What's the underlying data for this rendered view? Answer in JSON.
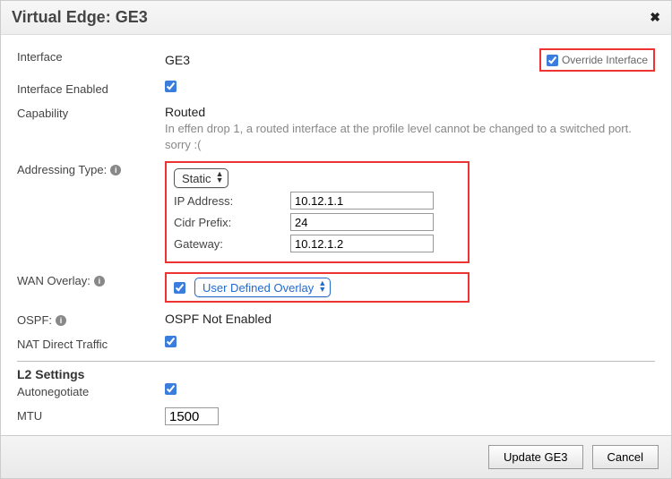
{
  "title": "Virtual Edge: GE3",
  "override": {
    "label": "Override Interface",
    "checked": true
  },
  "rows": {
    "interface": {
      "label": "Interface",
      "value": "GE3"
    },
    "enabled": {
      "label": "Interface Enabled",
      "checked": true
    },
    "capability": {
      "label": "Capability",
      "value": "Routed",
      "note": "In effen drop 1, a routed interface at the profile level cannot be changed to a switched port. sorry :("
    },
    "addressing": {
      "label": "Addressing Type:",
      "select": "Static",
      "ip_label": "IP Address:",
      "ip": "10.12.1.1",
      "cidr_label": "Cidr Prefix:",
      "cidr": "24",
      "gw_label": "Gateway:",
      "gw": "10.12.1.2"
    },
    "wan": {
      "label": "WAN Overlay:",
      "checked": true,
      "select": "User Defined Overlay"
    },
    "ospf": {
      "label": "OSPF:",
      "value": "OSPF Not Enabled"
    },
    "nat": {
      "label": "NAT Direct Traffic",
      "checked": true
    },
    "l2": {
      "title": "L2 Settings",
      "auto_label": "Autonegotiate",
      "auto_checked": true,
      "mtu_label": "MTU",
      "mtu": "1500"
    }
  },
  "buttons": {
    "update": "Update GE3",
    "cancel": "Cancel"
  }
}
